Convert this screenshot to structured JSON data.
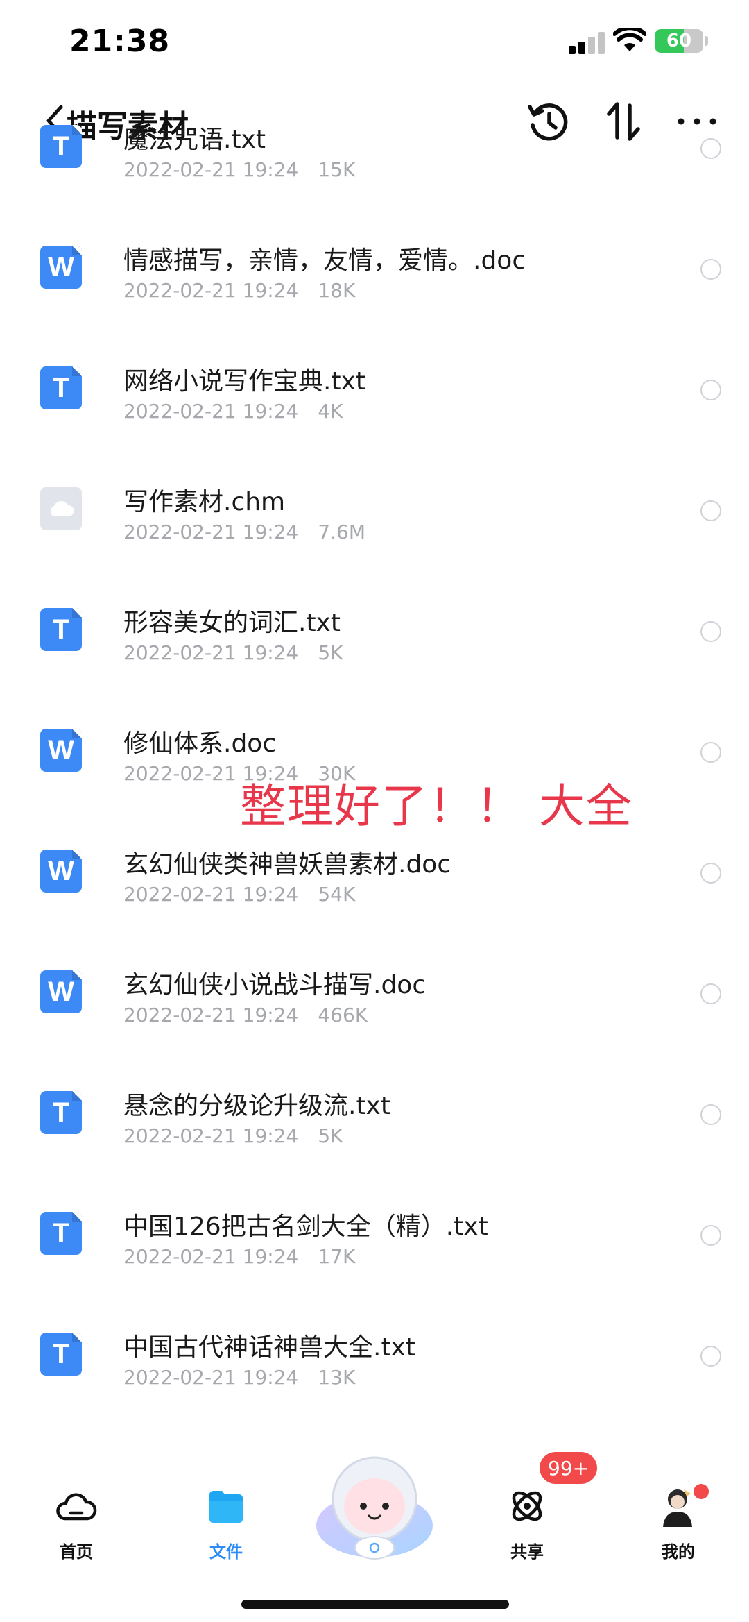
{
  "status_bar": {
    "time": "21:38",
    "battery": "60"
  },
  "nav": {
    "title": "描写素材",
    "back_icon": "chevron-left-icon",
    "history_icon": "history-icon",
    "sort_icon": "sort-icon",
    "more_icon": "more-icon"
  },
  "files": [
    {
      "name": "魔法咒语.txt",
      "date": "2022-02-21 19:24",
      "size": "15K",
      "type": "txt"
    },
    {
      "name": "情感描写，亲情，友情，爱情。.doc",
      "date": "2022-02-21 19:24",
      "size": "18K",
      "type": "doc"
    },
    {
      "name": "网络小说写作宝典.txt",
      "date": "2022-02-21 19:24",
      "size": "4K",
      "type": "txt"
    },
    {
      "name": "写作素材.chm",
      "date": "2022-02-21 19:24",
      "size": "7.6M",
      "type": "chm"
    },
    {
      "name": "形容美女的词汇.txt",
      "date": "2022-02-21 19:24",
      "size": "5K",
      "type": "txt"
    },
    {
      "name": "修仙体系.doc",
      "date": "2022-02-21 19:24",
      "size": "30K",
      "type": "doc"
    },
    {
      "name": "玄幻仙侠类神兽妖兽素材.doc",
      "date": "2022-02-21 19:24",
      "size": "54K",
      "type": "doc"
    },
    {
      "name": "玄幻仙侠小说战斗描写.doc",
      "date": "2022-02-21 19:24",
      "size": "466K",
      "type": "doc"
    },
    {
      "name": "悬念的分级论升级流.txt",
      "date": "2022-02-21 19:24",
      "size": "5K",
      "type": "txt"
    },
    {
      "name": "中国126把古名剑大全（精）.txt",
      "date": "2022-02-21 19:24",
      "size": "17K",
      "type": "txt"
    },
    {
      "name": "中国古代神话神兽大全.txt",
      "date": "2022-02-21 19:24",
      "size": "13K",
      "type": "txt"
    }
  ],
  "overlay_caption": "整理好了！！ 大全",
  "tabs": [
    {
      "label": "首页",
      "icon": "cloud-icon"
    },
    {
      "label": "文件",
      "icon": "folder-icon"
    },
    {
      "label": "共享",
      "icon": "orbit-icon"
    },
    {
      "label": "我的",
      "icon": "avatar-icon"
    }
  ],
  "share_badge": "99+",
  "colors": {
    "accent": "#2b8cf7",
    "file_icon": "#3d8af7",
    "badge": "#f24a4a",
    "caption": "#e8364a",
    "meta_text": "#a6a8ad"
  }
}
